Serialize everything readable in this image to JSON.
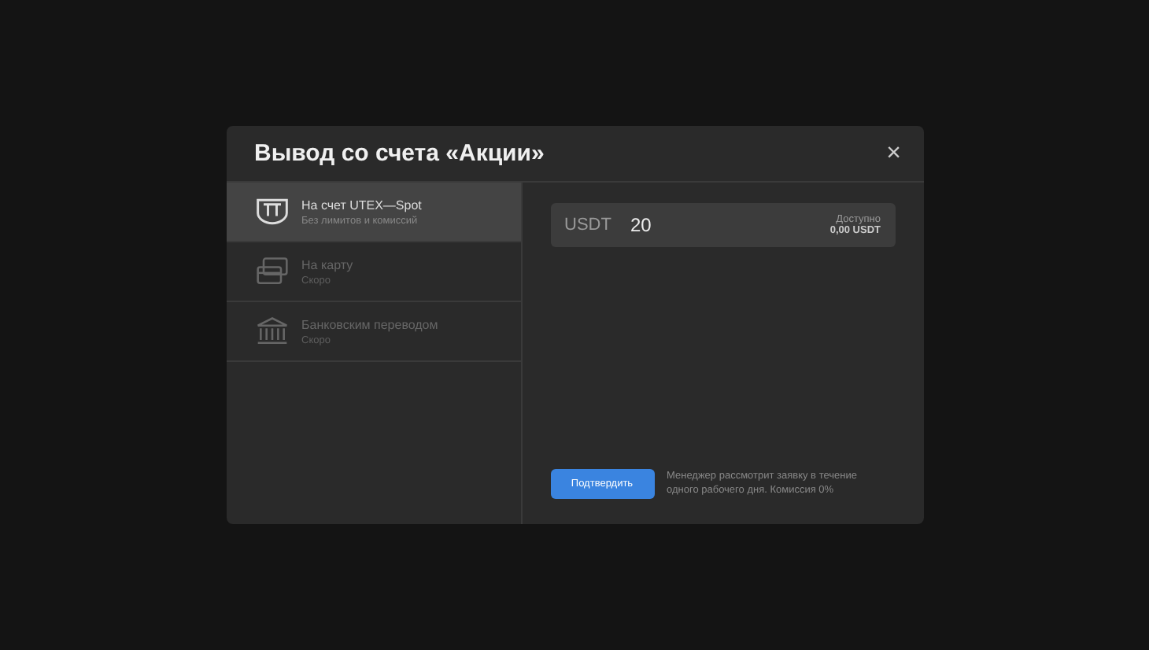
{
  "dialog": {
    "title": "Вывод со счета «Акции»",
    "close": "×"
  },
  "methods": [
    {
      "kind": "account",
      "label": "На счет UTEX—Spot",
      "sublabel": "Без лимитов и комиссий",
      "selected": true,
      "disabled": false
    },
    {
      "kind": "card",
      "label": "На карту",
      "sublabel": "Скоро",
      "selected": false,
      "disabled": true
    },
    {
      "kind": "bank",
      "label": "Банковским переводом",
      "sublabel": "Скоро",
      "selected": false,
      "disabled": true
    }
  ],
  "amount": {
    "currency": "USDT",
    "value": "20",
    "available_label": "Доступно",
    "available_value": "0,00 USDT"
  },
  "confirm_button": "Подтвердить",
  "note": "Менеджер рассмотрит заявку в течение одного рабочего дня. Комиссия 0%"
}
